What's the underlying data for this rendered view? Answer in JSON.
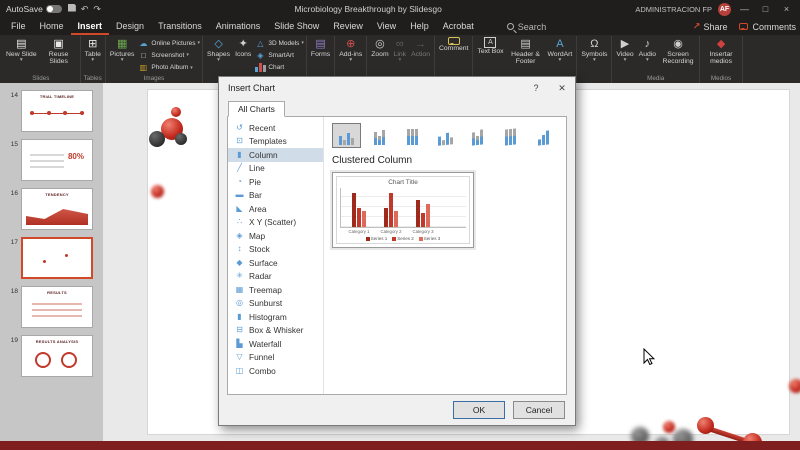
{
  "colors": {
    "accent": "#d2492a",
    "titlebar": "#1f1e1d",
    "ribbon": "#2b2a29",
    "status_bar": "#7e1e1e",
    "selection": "#d0dce8"
  },
  "title_bar": {
    "autosave_label": "AutoSave",
    "title": "Microbiology Breakthrough by Slidesgo",
    "user_name": "ADMINISTRACION FP",
    "avatar_initials": "AF"
  },
  "ribbon_tabs": {
    "items": [
      "File",
      "Home",
      "Insert",
      "Design",
      "Transitions",
      "Animations",
      "Slide Show",
      "Review",
      "View",
      "Help",
      "Acrobat"
    ],
    "active": "Insert",
    "search_label": "Search",
    "share_label": "Share",
    "comments_label": "Comments"
  },
  "ribbon_groups": [
    {
      "label": "Slides",
      "cols": [
        {
          "type": "large",
          "label": "New Slide",
          "icon": "new-slide",
          "menu": true
        },
        {
          "type": "large",
          "label": "Reuse Slides",
          "icon": "reuse-slides"
        }
      ]
    },
    {
      "label": "Tables",
      "cols": [
        {
          "type": "large",
          "label": "Table",
          "icon": "table",
          "menu": true
        }
      ]
    },
    {
      "label": "Images",
      "cols": [
        {
          "type": "large",
          "label": "Pictures",
          "icon": "pictures",
          "menu": true
        },
        {
          "type": "stack",
          "buttons": [
            {
              "label": "Online Pictures",
              "icon": "online-pictures",
              "menu": true
            },
            {
              "label": "Screenshot",
              "icon": "screenshot",
              "menu": true
            },
            {
              "label": "Photo Album",
              "icon": "photo-album",
              "menu": true
            }
          ]
        }
      ]
    },
    {
      "label": "",
      "cols": [
        {
          "type": "large",
          "label": "Shapes",
          "icon": "shapes",
          "menu": true
        },
        {
          "type": "large",
          "label": "Icons",
          "icon": "icons"
        },
        {
          "type": "stack",
          "buttons": [
            {
              "label": "3D Models",
              "icon": "3d-models",
              "menu": true
            },
            {
              "label": "SmartArt",
              "icon": "smartart"
            },
            {
              "label": "Chart",
              "icon": "chart"
            }
          ]
        }
      ]
    },
    {
      "label": "",
      "cols": [
        {
          "type": "large",
          "label": "Forms",
          "icon": "forms"
        }
      ]
    },
    {
      "label": "",
      "cols": [
        {
          "type": "large",
          "label": "Add-ins",
          "icon": "add-ins",
          "menu": true
        }
      ]
    },
    {
      "label": "",
      "cols": [
        {
          "type": "large",
          "label": "Zoom",
          "icon": "zoom"
        },
        {
          "type": "large",
          "label": "Link",
          "icon": "link",
          "menu": true,
          "disabled": true
        },
        {
          "type": "large",
          "label": "Action",
          "icon": "action",
          "disabled": true
        }
      ]
    },
    {
      "label": "",
      "cols": [
        {
          "type": "large",
          "label": "Comment",
          "icon": "comment"
        }
      ]
    },
    {
      "label": "",
      "cols": [
        {
          "type": "large",
          "label": "Text Box",
          "icon": "text-box"
        },
        {
          "type": "large",
          "label": "Header & Footer",
          "icon": "header-footer"
        },
        {
          "type": "large",
          "label": "WordArt",
          "icon": "wordart",
          "menu": true
        }
      ]
    },
    {
      "label": "",
      "cols": [
        {
          "type": "large",
          "label": "Symbols",
          "icon": "symbols",
          "menu": true
        }
      ]
    },
    {
      "label": "Media",
      "cols": [
        {
          "type": "large",
          "label": "Video",
          "icon": "video",
          "menu": true
        },
        {
          "type": "large",
          "label": "Audio",
          "icon": "audio",
          "menu": true
        },
        {
          "type": "large",
          "label": "Screen Recording",
          "icon": "screen-recording"
        }
      ]
    },
    {
      "label": "Medios",
      "cols": [
        {
          "type": "large",
          "label": "Insertar medios",
          "icon": "insertar-medios"
        }
      ]
    }
  ],
  "slides_panel": {
    "slides": [
      {
        "number": "14",
        "title": "TRIAL TIMELINE",
        "kind": "timeline",
        "selected": false
      },
      {
        "number": "15",
        "title": "80%",
        "kind": "stats",
        "selected": false
      },
      {
        "number": "16",
        "title": "TENDENCY",
        "kind": "area",
        "selected": false
      },
      {
        "number": "17",
        "title": "",
        "kind": "blank",
        "selected": true
      },
      {
        "number": "18",
        "title": "RESULTS",
        "kind": "table",
        "selected": false
      },
      {
        "number": "19",
        "title": "RESULTS ANALYSIS",
        "kind": "diagram",
        "selected": false
      }
    ]
  },
  "dialog": {
    "title": "Insert Chart",
    "help_icon": "?",
    "close_icon": "✕",
    "tabs": [
      "All Charts"
    ],
    "categories": [
      "Recent",
      "Templates",
      "Column",
      "Line",
      "Pie",
      "Bar",
      "Area",
      "X Y (Scatter)",
      "Map",
      "Stock",
      "Surface",
      "Radar",
      "Treemap",
      "Sunburst",
      "Histogram",
      "Box & Whisker",
      "Waterfall",
      "Funnel",
      "Combo"
    ],
    "selected_category": "Column",
    "subtypes": [
      "clustered-column",
      "stacked-column",
      "100%-stacked-column",
      "3d-clustered-column",
      "3d-stacked-column",
      "3d-100%-stacked-column",
      "3d-column"
    ],
    "selected_subtype_index": 0,
    "subtype_heading": "Clustered Column",
    "ok_label": "OK",
    "cancel_label": "Cancel"
  },
  "chart_data": {
    "type": "bar",
    "title": "Chart Title",
    "categories": [
      "Category 1",
      "Category 2",
      "Category 3"
    ],
    "series": [
      {
        "name": "Series 1",
        "color": "#9e2a1e",
        "values": [
          4.3,
          2.5,
          3.5
        ]
      },
      {
        "name": "Series 2",
        "color": "#c0392b",
        "values": [
          2.4,
          4.4,
          1.8
        ]
      },
      {
        "name": "Series 3",
        "color": "#e06a5a",
        "values": [
          2.0,
          2.0,
          3.0
        ]
      }
    ],
    "ylim": [
      0,
      5
    ],
    "grid": true,
    "legend_position": "bottom"
  }
}
